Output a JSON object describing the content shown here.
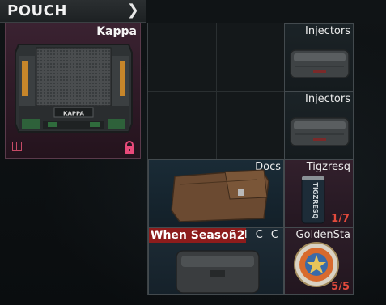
{
  "header": {
    "title": "POUCH",
    "expand_icon": "chevron-right-icon"
  },
  "kappa": {
    "name": "Kappa",
    "case_label": "KAPPA",
    "slot_color": "#3a2231",
    "grid_icon": "grid-icon",
    "lock_icon": "lock-icon",
    "lock_color": "#e84a7a"
  },
  "items": {
    "injectors_1": {
      "label": "Injectors"
    },
    "injectors_2": {
      "label": "Injectors"
    },
    "docs": {
      "label": "Docs"
    },
    "tigzresq": {
      "label": "Tigzresq",
      "count": "1/7",
      "can_text": "TIGZRESQ"
    },
    "sicc": {
      "label": "S I C C",
      "banner": "When Season2"
    },
    "golden": {
      "label": "GoldenSta",
      "count": "5/5"
    }
  },
  "colors": {
    "count_red": "#e24a3c",
    "banner_red": "#8c1c1c"
  }
}
